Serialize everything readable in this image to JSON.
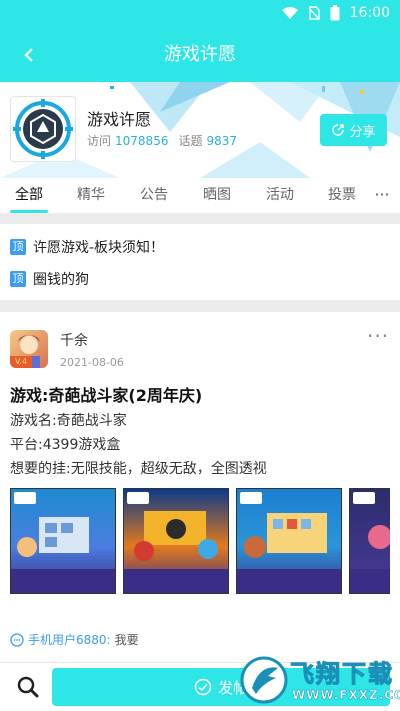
{
  "status_bar": {
    "time": "16:00"
  },
  "app_bar": {
    "title": "游戏许愿"
  },
  "forum": {
    "name": "游戏许愿",
    "visits_label": "访问",
    "visits": "1078856",
    "topics_label": "话题",
    "topics": "9837",
    "share_label": "分享"
  },
  "tabs": [
    {
      "label": "全部",
      "active": true
    },
    {
      "label": "精华"
    },
    {
      "label": "公告"
    },
    {
      "label": "晒图"
    },
    {
      "label": "活动"
    },
    {
      "label": "投票"
    }
  ],
  "pinned": [
    {
      "badge": "顶",
      "text": "许愿游戏-板块须知！"
    },
    {
      "badge": "顶",
      "text": "圈钱的狗"
    }
  ],
  "post": {
    "author": "千余",
    "level": "V.4",
    "date": "2021-08-06",
    "title": "游戏:奇葩战斗家(2周年庆)",
    "lines": [
      "游戏名:奇葩战斗家",
      "平台:4399游戏盒",
      "想要的挂:无限技能，超级无敌，全图透视"
    ],
    "comment_user": "手机用户6880:",
    "comment_text": "我要"
  },
  "bottom": {
    "post_label": "发帖"
  },
  "watermark": {
    "line1": "飞翔下载",
    "line2": "WWW.FXXZ.COM"
  },
  "colors": {
    "accent": "#2ee6e6",
    "link": "#2aaee0",
    "pin": "#3b9cf0"
  }
}
